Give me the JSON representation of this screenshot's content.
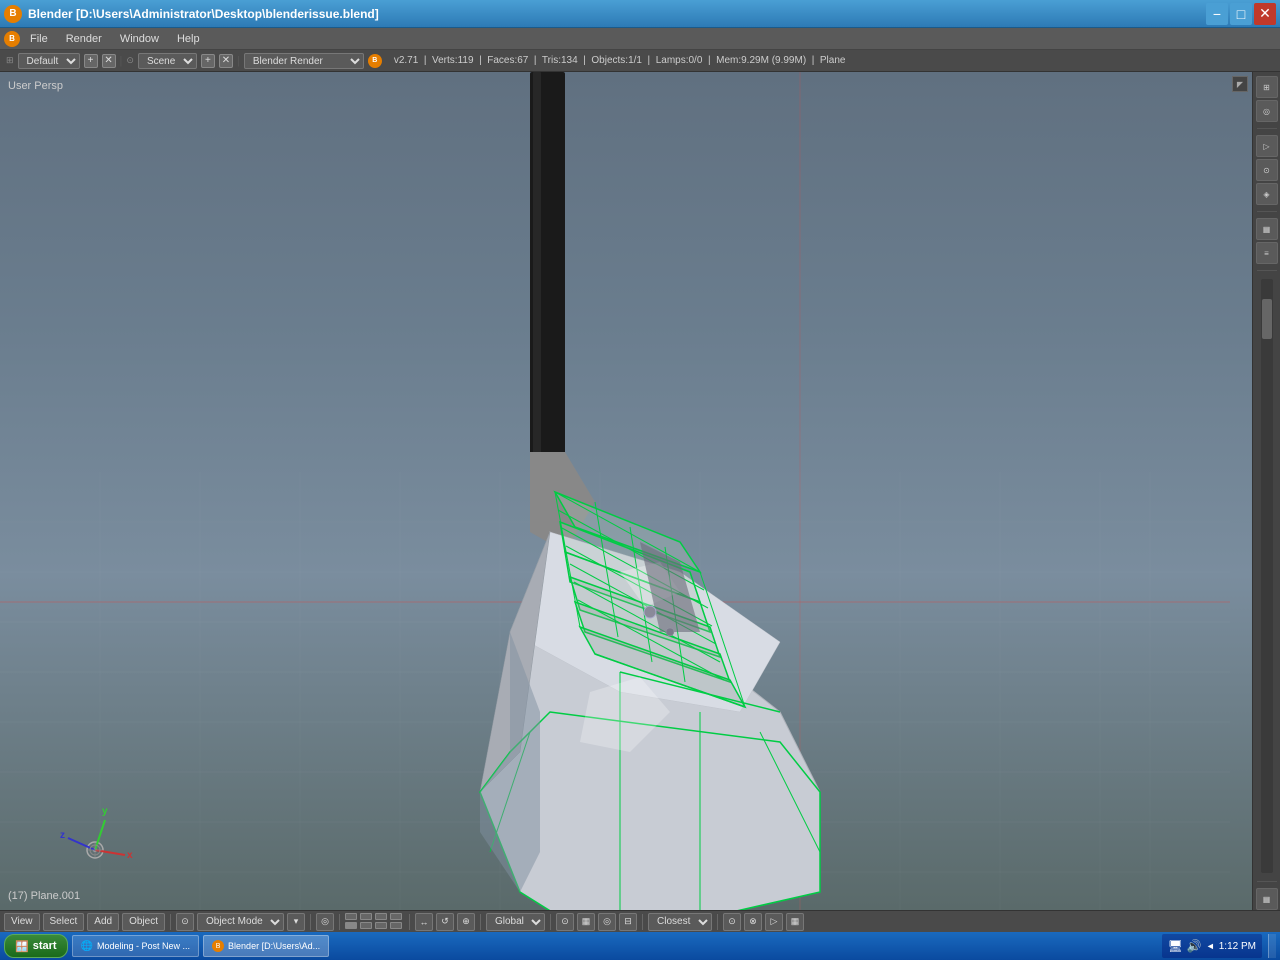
{
  "window": {
    "title": "Blender [D:\\Users\\Administrator\\Desktop\\blenderissue.blend]",
    "icon": "B"
  },
  "title_bar": {
    "minimize_label": "−",
    "maximize_label": "□",
    "close_label": "✕"
  },
  "menu_bar": {
    "items": [
      "File",
      "Render",
      "Window",
      "Help"
    ]
  },
  "info_bar": {
    "engine_label": "Blender Render",
    "version": "v2.71",
    "verts": "Verts:119",
    "faces": "Faces:67",
    "tris": "Tris:134",
    "objects": "Objects:1/1",
    "lamps": "Lamps:0/0",
    "memory": "Mem:9.29M (9.99M)",
    "plane": "Plane",
    "layout_default": "Default",
    "scene_label": "Scene"
  },
  "viewport": {
    "label": "User Persp",
    "expand_icon": "◤"
  },
  "axis": {
    "x_label": "x",
    "y_label": "y",
    "z_label": "z"
  },
  "object_label": "(17) Plane.001",
  "bottom_toolbar": {
    "view_btn": "View",
    "select_btn": "Select",
    "add_btn": "Add",
    "object_btn": "Object",
    "mode_label": "Object Mode",
    "global_label": "Global",
    "closest_label": "Closest"
  },
  "taskbar": {
    "start_label": "start",
    "items": [
      {
        "label": "Modeling - Post New ...",
        "icon": "ie"
      },
      {
        "label": "Blender [D:\\Users\\Ad...",
        "icon": "blend",
        "active": true
      }
    ],
    "show_desktop": "Show Desktop"
  },
  "clock": {
    "time": "1:12 PM"
  },
  "sidebar_buttons": [
    "⊞",
    "◎",
    "↔",
    "↕",
    "⊕",
    "≡",
    "▦",
    "◈"
  ],
  "toolbar_icons": {
    "mode_icon": "⊙",
    "pivot_icon": "◎",
    "snap_grid": "▦",
    "proportional": "◎",
    "mirror": "⊟",
    "render_icon": "▷"
  }
}
